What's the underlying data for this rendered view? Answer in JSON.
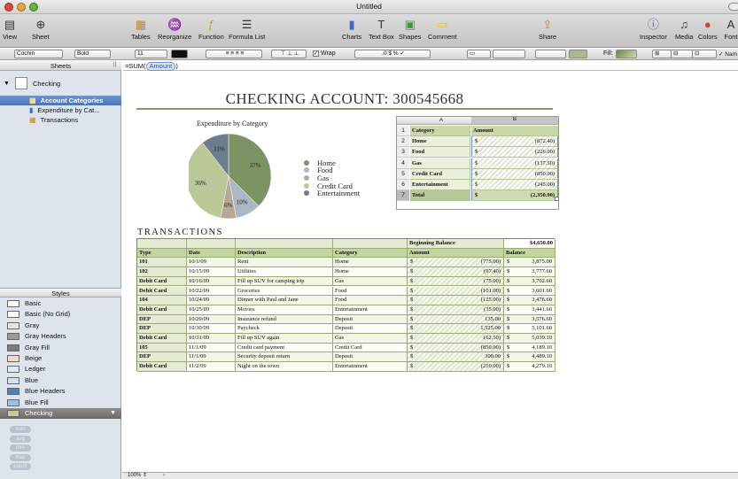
{
  "window": {
    "title": "Untitled"
  },
  "toolbar": {
    "left": [
      {
        "label": "View",
        "icon": "view-icon"
      },
      {
        "label": "Sheet",
        "icon": "sheet-icon"
      }
    ],
    "middle": [
      {
        "label": "Tables",
        "icon": "tables-icon"
      },
      {
        "label": "Reorganize",
        "icon": "reorganize-icon"
      },
      {
        "label": "Function",
        "icon": "function-icon"
      },
      {
        "label": "Formula List",
        "icon": "formula-list-icon"
      },
      {
        "label": "Charts",
        "icon": "charts-icon"
      },
      {
        "label": "Text Box",
        "icon": "text-box-icon"
      },
      {
        "label": "Shapes",
        "icon": "shapes-icon"
      },
      {
        "label": "Comment",
        "icon": "comment-icon"
      }
    ],
    "share": {
      "label": "Share",
      "icon": "share-icon"
    },
    "right": [
      {
        "label": "Inspector",
        "icon": "inspector-icon"
      },
      {
        "label": "Media",
        "icon": "media-icon"
      },
      {
        "label": "Colors",
        "icon": "colors-icon"
      },
      {
        "label": "Font",
        "icon": "fonts-icon"
      }
    ]
  },
  "format_bar": {
    "font": "Cochin",
    "style": "Bold",
    "size": "11",
    "wrap_label": "Wrap",
    "fill_label": "Fill:",
    "last_label": "Nam"
  },
  "sidebar": {
    "sheets_header": "Sheets",
    "sheet": {
      "name": "Checking"
    },
    "items": [
      {
        "label": "Account Categories",
        "selected": true
      },
      {
        "label": "Expenditure by Cat...",
        "selected": false
      },
      {
        "label": "Transactions",
        "selected": false
      }
    ],
    "styles_header": "Styles",
    "styles": [
      {
        "label": "Basic",
        "color": "#ffffff"
      },
      {
        "label": "Basic (No Grid)",
        "color": "#ffffff"
      },
      {
        "label": "Gray",
        "color": "#e6e6e6"
      },
      {
        "label": "Gray Headers",
        "color": "#9a9a9a"
      },
      {
        "label": "Gray Fill",
        "color": "#7a7a7a"
      },
      {
        "label": "Beige",
        "color": "#e9dfc6"
      },
      {
        "label": "Ledger",
        "color": "#dfe8f4"
      },
      {
        "label": "Blue",
        "color": "#cfe0f6"
      },
      {
        "label": "Blue Headers",
        "color": "#4f7fbf"
      },
      {
        "label": "Blue Fill",
        "color": "#9fc0e8"
      },
      {
        "label": "Checking",
        "color": "#c2cf9a",
        "selected": true
      }
    ],
    "functions": [
      "sum",
      "avg",
      "min",
      "max",
      "count"
    ]
  },
  "formula_bar": {
    "prefix": "=SUM(",
    "token": "Amount",
    "suffix": ")"
  },
  "document": {
    "title": "CHECKING ACCOUNT: 300545668",
    "chart_title": "Expenditure by Category",
    "transactions_header": "TRANSACTIONS"
  },
  "chart_data": {
    "type": "pie",
    "title": "Expenditure by Category",
    "legend_position": "right",
    "slices": [
      {
        "label": "Home",
        "value": 872.4,
        "percent_label": "37%",
        "color": "#7c9463"
      },
      {
        "label": "Food",
        "value": 226.0,
        "percent_label": "10%",
        "color": "#a9b8c2"
      },
      {
        "label": "Gas",
        "value": 137.5,
        "percent_label": "6%",
        "color": "#b7a896"
      },
      {
        "label": "Credit Card",
        "value": 850.0,
        "percent_label": "36%",
        "color": "#b9c896"
      },
      {
        "label": "Entertainment",
        "value": 245.0,
        "percent_label": "11%",
        "color": "#6b7d8f"
      }
    ]
  },
  "summary_table": {
    "col_headers": [
      "A",
      "B"
    ],
    "row_numbers": [
      "1",
      "2",
      "3",
      "4",
      "5",
      "6",
      "7"
    ],
    "header": [
      "Category",
      "Amount"
    ],
    "rows": [
      {
        "category": "Home",
        "currency": "$",
        "amount": "(872.40)"
      },
      {
        "category": "Food",
        "currency": "$",
        "amount": "(226.00)"
      },
      {
        "category": "Gas",
        "currency": "$",
        "amount": "(137.50)"
      },
      {
        "category": "Credit Card",
        "currency": "$",
        "amount": "(850.00)"
      },
      {
        "category": "Entertainment",
        "currency": "$",
        "amount": "(245.00)"
      }
    ],
    "total": {
      "category": "Total",
      "currency": "$",
      "amount": "(2,350.90)"
    }
  },
  "transactions": {
    "beginning_label": "Beginning Balance",
    "beginning_value": "$4,650.00",
    "headers": [
      "Type",
      "Date",
      "Description",
      "Category",
      "Amount",
      "Balance"
    ],
    "rows": [
      [
        "101",
        "10/1/09",
        "Rent",
        "Home",
        "(775.00)",
        "3,875.00"
      ],
      [
        "102",
        "10/15/09",
        "Utilities",
        "Home",
        "(97.40)",
        "3,777.60"
      ],
      [
        "Debit Card",
        "10/16/09",
        "Fill up SUV for camping trip",
        "Gas",
        "(75.00)",
        "3,702.60"
      ],
      [
        "Debit Card",
        "10/22/09",
        "Groceries",
        "Food",
        "(101.00)",
        "3,601.60"
      ],
      [
        "104",
        "10/24/09",
        "Dinner with Paul and Jane",
        "Food",
        "(125.00)",
        "3,476.60"
      ],
      [
        "Debit Card",
        "10/25/09",
        "Movies",
        "Entertainment",
        "(35.00)",
        "3,441.60"
      ],
      [
        "DEP",
        "10/29/09",
        "Insurance refund",
        "Deposit",
        "135.00",
        "3,576.60"
      ],
      [
        "DEP",
        "10/30/09",
        "Paycheck",
        "Deposit",
        "1,525.00",
        "5,101.60"
      ],
      [
        "Debit Card",
        "10/31/09",
        "Fill up SUV again",
        "Gas",
        "(62.50)",
        "5,039.10"
      ],
      [
        "105",
        "11/1/09",
        "Credit card payment",
        "Credit Card",
        "(850.00)",
        "4,189.10"
      ],
      [
        "DEP",
        "11/1/09",
        "Security deposit return",
        "Deposit",
        "300.00",
        "4,489.10"
      ],
      [
        "Debit Card",
        "11/2/09",
        "Night on the town",
        "Entertainment",
        "(210.00)",
        "4,279.10"
      ]
    ],
    "currency": "$"
  },
  "status": {
    "zoom": "100%"
  }
}
